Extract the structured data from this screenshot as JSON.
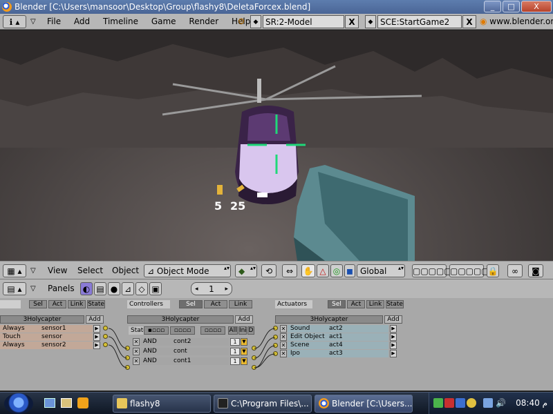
{
  "window": {
    "title": "Blender [C:\\Users\\mansoor\\Desktop\\Group\\flashy8\\DeletaForcex.blend]",
    "min": "_",
    "max": "□",
    "close": "X"
  },
  "info_header": {
    "menus": [
      "File",
      "Add",
      "Timeline",
      "Game",
      "Render",
      "Help"
    ],
    "screen_field": "SR:2-Model",
    "scene_field": "SCE:StartGame2",
    "x_label": "X",
    "url": "www.blender.org"
  },
  "hud": {
    "ammo_clips": "5",
    "ammo_rounds": "25"
  },
  "view_header": {
    "menus": [
      "View",
      "Select",
      "Object"
    ],
    "mode": "Object Mode",
    "orientation": "Global"
  },
  "buttons_header": {
    "panels_label": "Panels",
    "frame": "1"
  },
  "logic": {
    "tabs": {
      "sel": "Sel",
      "act": "Act",
      "link": "Link",
      "state": "State"
    },
    "controllers_label": "Controllers",
    "actuators_label": "Actuators",
    "object_name": "3Holycapter",
    "add_label": "Add",
    "state_label": "State",
    "all_label": "All",
    "ini_label": "Ini",
    "d_label": "D",
    "sensors": [
      {
        "type": "Always",
        "name": "sensor1"
      },
      {
        "type": "Touch",
        "name": "sensor"
      },
      {
        "type": "Always",
        "name": "sensor2"
      }
    ],
    "controllers": [
      {
        "type": "AND",
        "name": "cont2",
        "state": "1"
      },
      {
        "type": "AND",
        "name": "cont",
        "state": "1"
      },
      {
        "type": "AND",
        "name": "cont1",
        "state": "1"
      }
    ],
    "actuators": [
      {
        "type": "Sound",
        "name": "act2"
      },
      {
        "type": "Edit Object",
        "name": "act1"
      },
      {
        "type": "Scene",
        "name": "act4"
      },
      {
        "type": "Ipo",
        "name": "act3"
      }
    ]
  },
  "taskbar": {
    "tasks": [
      {
        "label": "flashy8"
      },
      {
        "label": "C:\\Program Files\\..."
      },
      {
        "label": "Blender [C:\\Users..."
      }
    ],
    "clock": "08:40",
    "ampm": "م"
  }
}
